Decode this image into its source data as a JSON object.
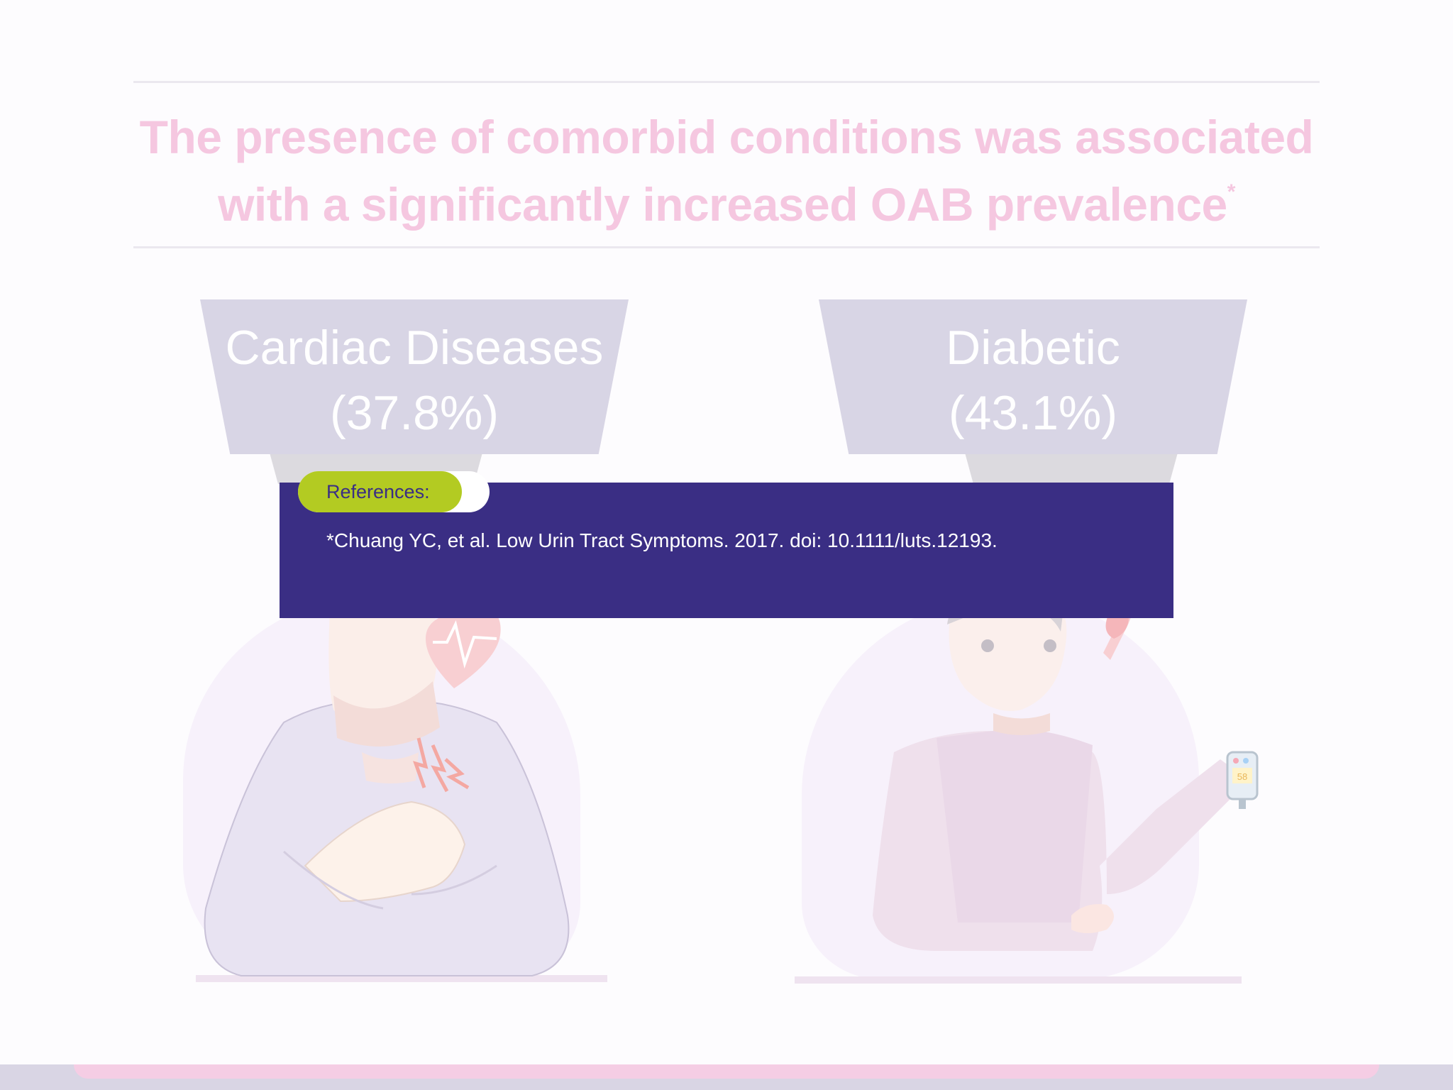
{
  "title": {
    "text": "The presence of comorbid conditions was associated with a significantly increased OAB prevalence",
    "marker": "*"
  },
  "stats": [
    {
      "label": "Cardiac Diseases",
      "value": "(37.8%)"
    },
    {
      "label": "Diabetic",
      "value": "(43.1%)"
    }
  ],
  "references": {
    "label": "References:",
    "text": "*Chuang YC, et al. Low Urin Tract Symptoms. 2017. doi: 10.1111/luts.12193."
  },
  "illustrations": {
    "left": "man-holding-chest-icon",
    "right": "man-with-glucose-meter-icon",
    "glucose_reading": "58"
  },
  "colors": {
    "title": "#f5c7e0",
    "stat_box": "#d8d5e5",
    "reference_panel": "#3a2e84",
    "reference_pill": "#b3cb22",
    "footer_pink": "#f5cde4"
  }
}
